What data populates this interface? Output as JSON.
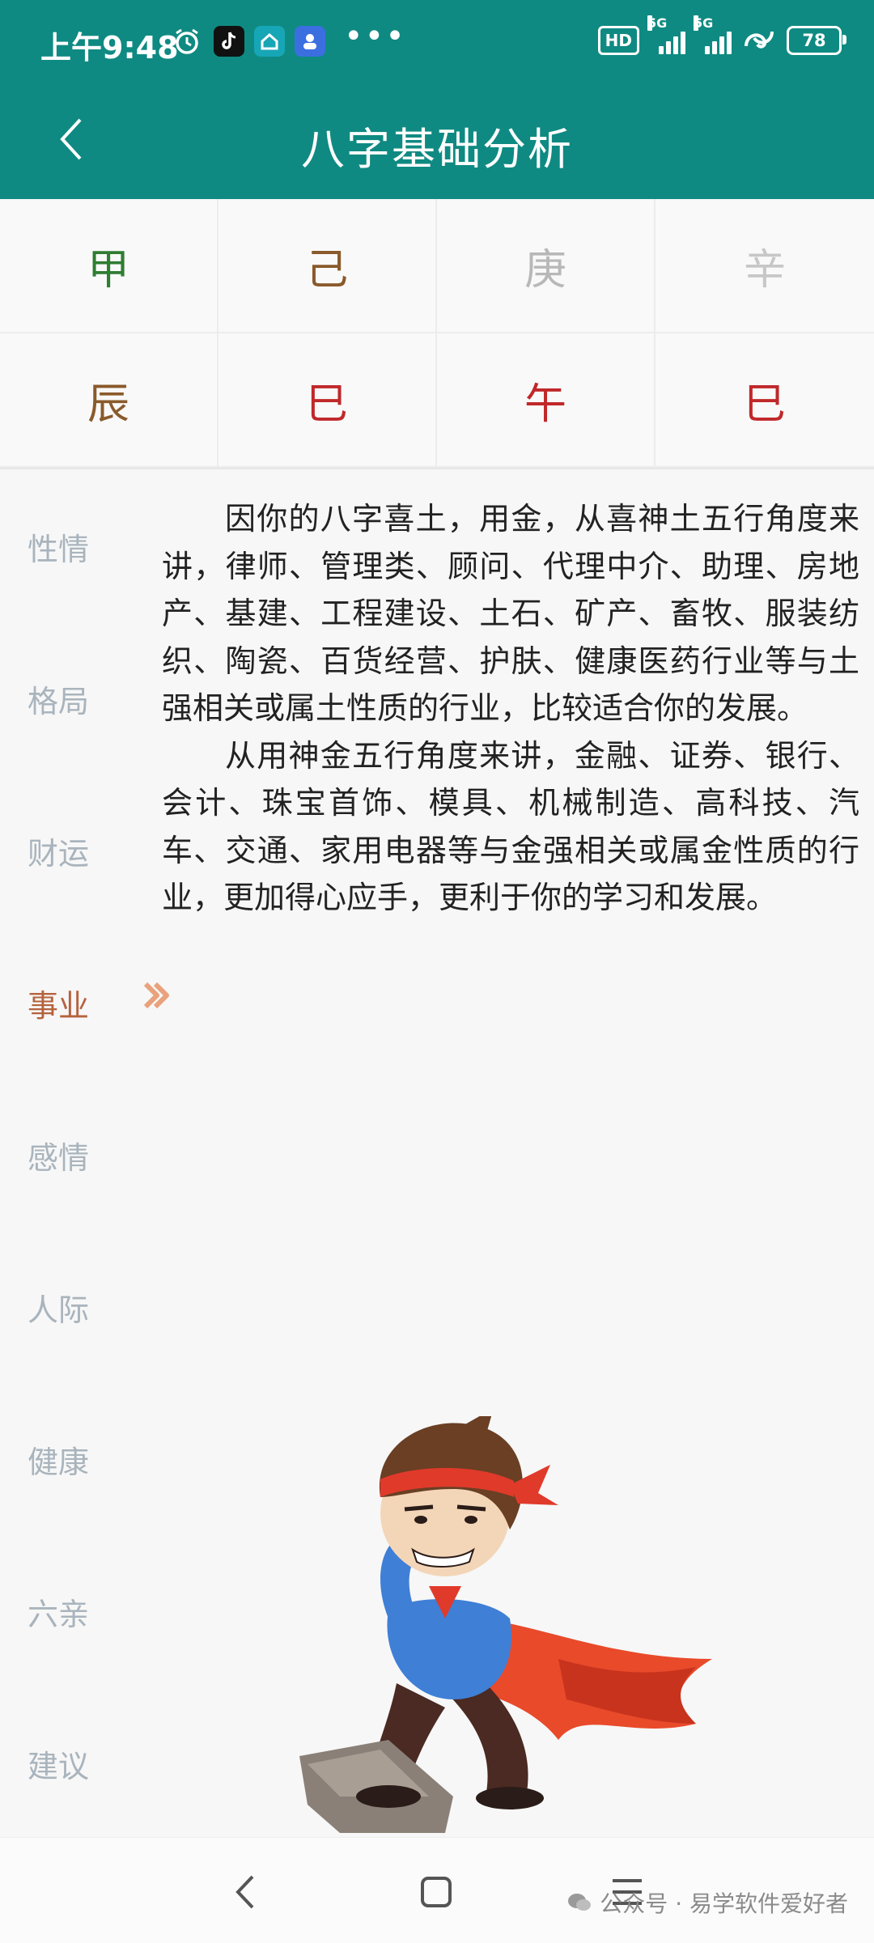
{
  "status_bar": {
    "time": "上午9:48",
    "hd_label": "HD",
    "net1": "5G",
    "net2": "5G",
    "battery": "78"
  },
  "app_bar": {
    "title": "八字基础分析"
  },
  "pillars": {
    "stems": [
      {
        "char": "甲",
        "color": "#2f7d32"
      },
      {
        "char": "己",
        "color": "#8a5a2b"
      },
      {
        "char": "庚",
        "color": "#b8b8b8"
      },
      {
        "char": "辛",
        "color": "#c7c7c7"
      }
    ],
    "branches": [
      {
        "char": "辰",
        "color": "#8a5a2b"
      },
      {
        "char": "巳",
        "color": "#c0282a"
      },
      {
        "char": "午",
        "color": "#c0282a"
      },
      {
        "char": "巳",
        "color": "#c0282a"
      }
    ]
  },
  "side_menu": {
    "items": [
      "性情",
      "格局",
      "财运",
      "事业",
      "感情",
      "人际",
      "健康",
      "六亲",
      "建议"
    ],
    "active": "事业"
  },
  "content": {
    "paragraphs": [
      "因你的八字喜土，用金，从喜神土五行角度来讲，律师、管理类、顾问、代理中介、助理、房地产、基建、工程建设、土石、矿产、畜牧、服装纺织、陶瓷、百货经营、护肤、健康医药行业等与土强相关或属土性质的行业，比较适合你的发展。",
      "从用神金五行角度来讲，金融、证券、银行、会计、珠宝首饰、模具、机械制造、高科技、汽车、交通、家用电器等与金强相关或属金性质的行业，更加得心应手，更利于你的学习和发展。"
    ]
  },
  "watermark": "公众号 · 易学软件爱好者",
  "colors": {
    "primary": "#0f8a82",
    "active": "#b5623e",
    "inactive": "#a9b4bd"
  }
}
